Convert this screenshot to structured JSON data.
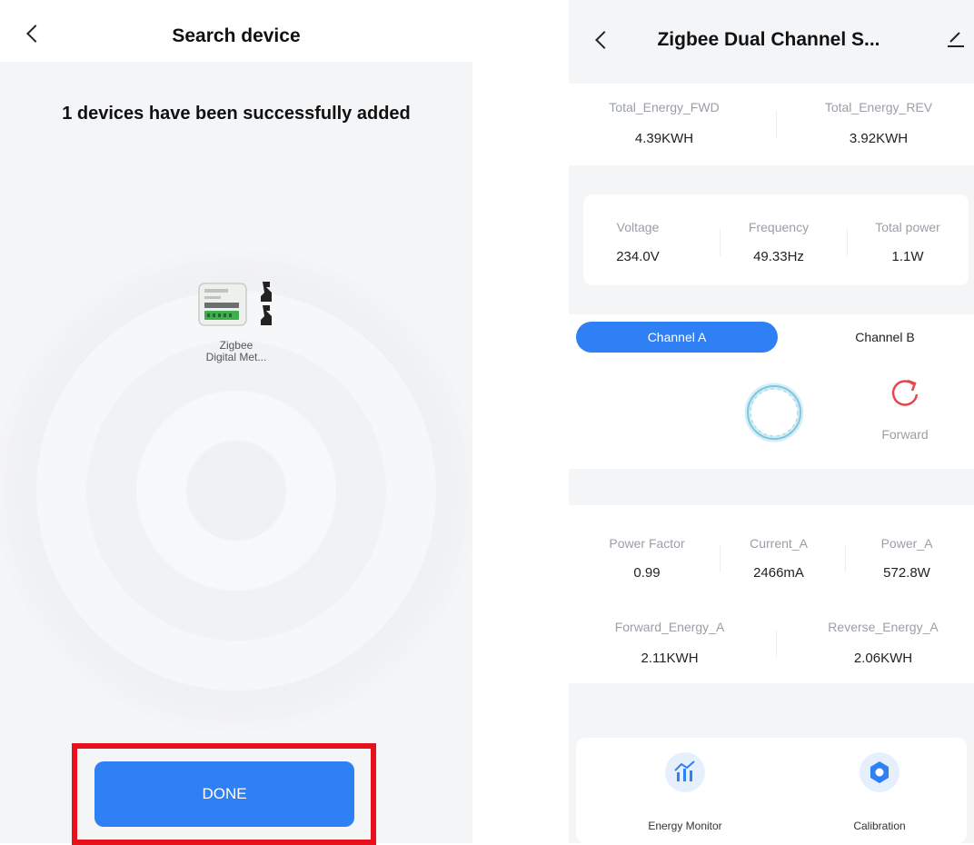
{
  "search_screen": {
    "back_icon": "chevron-left-icon",
    "title": "Search device",
    "success_message": "1 devices have been successfully added",
    "device_name": "Zigbee\nDigital Met...",
    "done_label": "DONE",
    "colors": {
      "accent": "#2f7ff5",
      "highlight": "#e8101a"
    }
  },
  "device_screen": {
    "back_icon": "chevron-left-icon",
    "title": "Zigbee Dual Channel S...",
    "edit_icon": "pencil-icon",
    "energy_totals": [
      {
        "label": "Total_Energy_FWD",
        "value": "4.39KWH"
      },
      {
        "label": "Total_Energy_REV",
        "value": "3.92KWH"
      }
    ],
    "electrical": [
      {
        "label": "Voltage",
        "value": "234.0V"
      },
      {
        "label": "Frequency",
        "value": "49.33Hz"
      },
      {
        "label": "Total power",
        "value": "1.1W"
      }
    ],
    "tabs": [
      {
        "label": "Channel A",
        "active": true
      },
      {
        "label": "Channel B",
        "active": false
      }
    ],
    "direction_label": "Forward",
    "channel_metrics": [
      {
        "label": "Power Factor",
        "value": "0.99"
      },
      {
        "label": "Current_A",
        "value": "2466mA"
      },
      {
        "label": "Power_A",
        "value": "572.8W"
      }
    ],
    "channel_energy": [
      {
        "label": "Forward_Energy_A",
        "value": "2.11KWH"
      },
      {
        "label": "Reverse_Energy_A",
        "value": "2.06KWH"
      }
    ],
    "bottom_actions": [
      {
        "label": "Energy Monitor",
        "icon": "bar-chart-icon"
      },
      {
        "label": "Calibration",
        "icon": "calibration-icon"
      }
    ],
    "colors": {
      "accent": "#2f7ff5",
      "direction_icon": "#e8454a"
    }
  }
}
